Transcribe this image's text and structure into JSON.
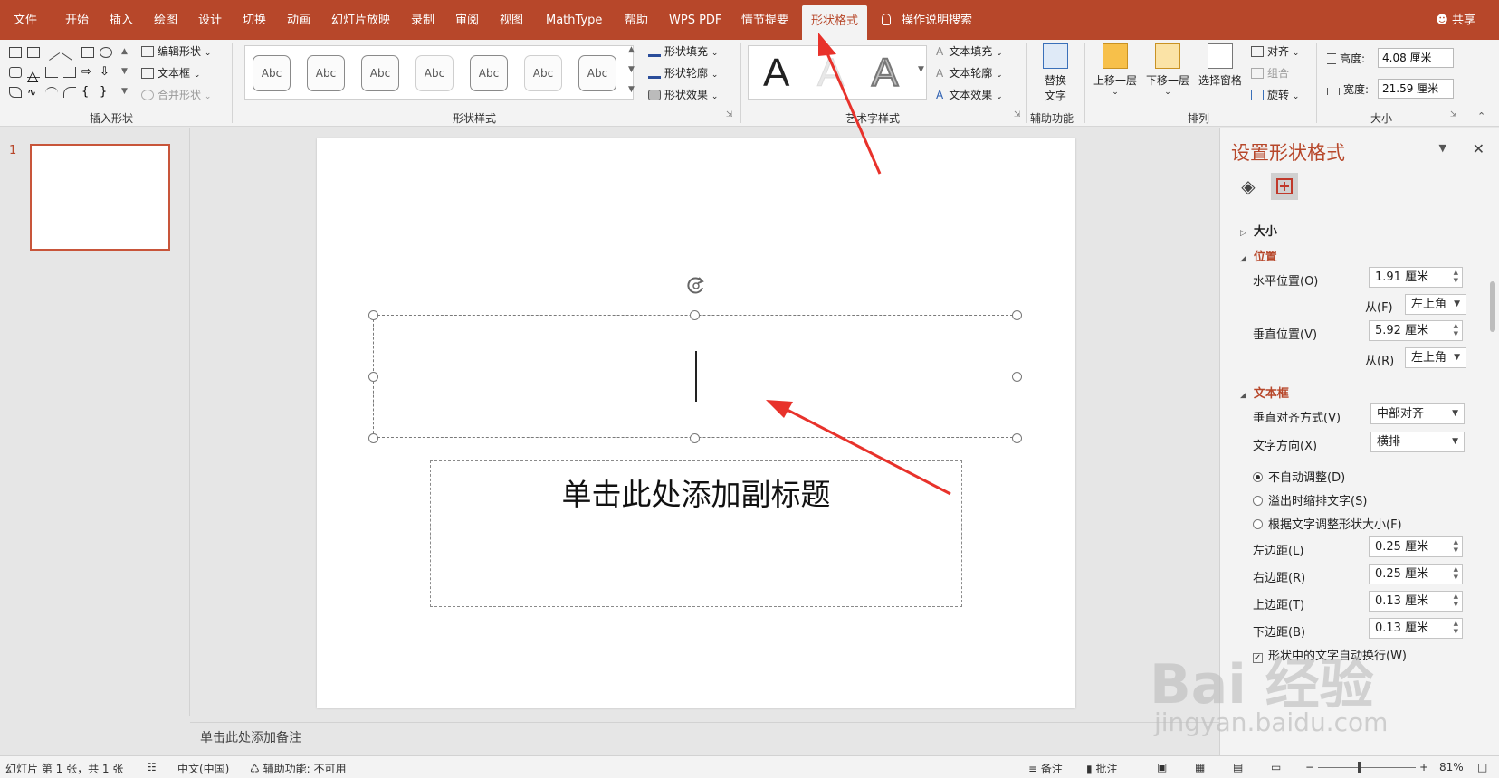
{
  "menu": {
    "tabs": [
      "文件",
      "开始",
      "插入",
      "绘图",
      "设计",
      "切换",
      "动画",
      "幻灯片放映",
      "录制",
      "审阅",
      "视图",
      "MathType",
      "帮助",
      "WPS PDF",
      "情节提要",
      "形状格式"
    ],
    "active_tab": "形状格式",
    "search": "操作说明搜索",
    "share": "共享"
  },
  "ribbon": {
    "insert_shapes": {
      "edit_shape": "编辑形状",
      "textbox": "文本框",
      "merge_shapes": "合并形状",
      "label": "插入形状"
    },
    "shape_styles": {
      "presets": [
        "Abc",
        "Abc",
        "Abc",
        "Abc",
        "Abc",
        "Abc",
        "Abc"
      ],
      "fill": "形状填充",
      "outline": "形状轮廓",
      "effects": "形状效果",
      "label": "形状样式"
    },
    "wordart": {
      "letters": [
        "A",
        "A",
        "A"
      ],
      "text_fill": "文本填充",
      "text_outline": "文本轮廓",
      "text_effects": "文本效果",
      "label": "艺术字样式"
    },
    "accessibility": {
      "alt_text_line1": "替换",
      "alt_text_line2": "文字",
      "label": "辅助功能"
    },
    "arrange": {
      "bring_forward": "上移一层",
      "send_backward": "下移一层",
      "selection_pane": "选择窗格",
      "align": "对齐",
      "group": "组合",
      "rotate": "旋转",
      "label": "排列"
    },
    "size": {
      "height_label": "高度:",
      "height_value": "4.08 厘米",
      "width_label": "宽度:",
      "width_value": "21.59 厘米",
      "label": "大小"
    }
  },
  "thumbnails": {
    "slide_number": "1"
  },
  "slide": {
    "subtitle_placeholder": "单击此处添加副标题"
  },
  "notes": {
    "placeholder": "单击此处添加备注"
  },
  "format_pane": {
    "title": "设置形状格式",
    "sections": {
      "size": "大小",
      "position": "位置",
      "textbox": "文本框"
    },
    "position": {
      "horizontal_label": "水平位置(O)",
      "horizontal_value": "1.91 厘米",
      "from_h_label": "从(F)",
      "from_h_value": "左上角",
      "vertical_label": "垂直位置(V)",
      "vertical_value": "5.92 厘米",
      "from_v_label": "从(R)",
      "from_v_value": "左上角"
    },
    "textbox": {
      "valign_label": "垂直对齐方式(V)",
      "valign_value": "中部对齐",
      "direction_label": "文字方向(X)",
      "direction_value": "横排",
      "autofit_none": "不自动调整(D)",
      "autofit_shrink": "溢出时缩排文字(S)",
      "autofit_resize": "根据文字调整形状大小(F)",
      "left_margin_label": "左边距(L)",
      "left_margin_value": "0.25 厘米",
      "right_margin_label": "右边距(R)",
      "right_margin_value": "0.25 厘米",
      "top_margin_label": "上边距(T)",
      "top_margin_value": "0.13 厘米",
      "bottom_margin_label": "下边距(B)",
      "bottom_margin_value": "0.13 厘米",
      "wrap_label": "形状中的文字自动换行(W)"
    }
  },
  "statusbar": {
    "slide_info": "幻灯片 第 1 张，共 1 张",
    "language": "中文(中国)",
    "accessibility": "辅助功能: 不可用",
    "notes": "备注",
    "comments": "批注",
    "zoom": "81%"
  },
  "watermark": {
    "logo": "Bai 经验",
    "url": "jingyan.baidu.com"
  },
  "colors": {
    "accent": "#b7472a",
    "arrow": "#e8322b"
  }
}
